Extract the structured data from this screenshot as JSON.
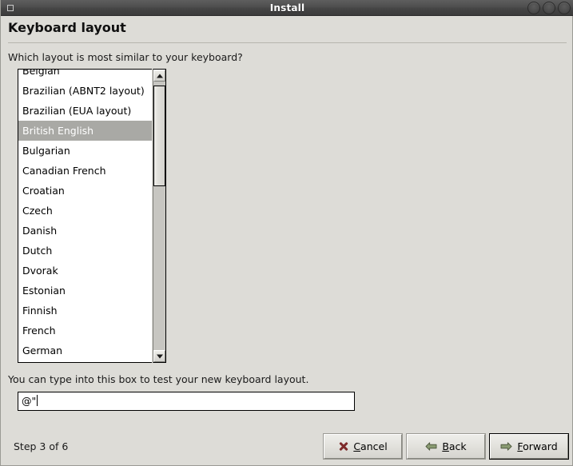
{
  "window": {
    "title": "Install",
    "menu_icon": "window-menu-icon",
    "buttons": [
      {
        "name": "minimize-button",
        "icon": "minimize-icon"
      },
      {
        "name": "maximize-button",
        "icon": "maximize-icon"
      },
      {
        "name": "close-button",
        "icon": "close-icon"
      }
    ]
  },
  "page": {
    "heading": "Keyboard layout",
    "question": "Which layout is most similar to your keyboard?"
  },
  "keyboard_list": {
    "selected": "British English",
    "items": [
      "Belgian",
      "Brazilian (ABNT2 layout)",
      "Brazilian (EUA layout)",
      "British English",
      "Bulgarian",
      "Canadian French",
      "Croatian",
      "Czech",
      "Danish",
      "Dutch",
      "Dvorak",
      "Estonian",
      "Finnish",
      "French",
      "German"
    ]
  },
  "scrollbar": {
    "up_arrow": "scroll-up-icon",
    "down_arrow": "scroll-down-icon",
    "thumb": "scrollbar-thumb"
  },
  "test_area": {
    "label": "You can type into this box to test your new keyboard layout.",
    "value": "@\"",
    "placeholder": ""
  },
  "footer": {
    "step": "Step 3 of 6",
    "cancel": {
      "label": "Cancel",
      "mnemonic": "C",
      "icon": "cancel-x-icon"
    },
    "back": {
      "label": "Back",
      "mnemonic": "B",
      "icon": "arrow-left-icon"
    },
    "forward": {
      "label": "Forward",
      "mnemonic": "F",
      "icon": "arrow-right-icon"
    }
  },
  "colors": {
    "window_bg": "#dddcd7",
    "titlebar": "#4a4a4a",
    "selection_bg": "#a9a9a5",
    "cancel_icon": "#7e2a2a",
    "nav_arrow": "#7f9168"
  }
}
